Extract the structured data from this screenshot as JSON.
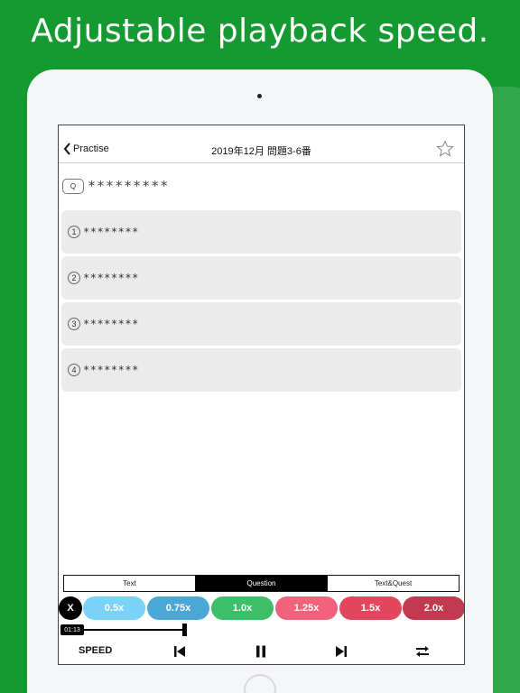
{
  "promo": {
    "title": "Adjustable playback speed."
  },
  "navbar": {
    "back_label": "Practise",
    "title": "2019年12月 問題3-6番"
  },
  "question": {
    "badge": "Q",
    "text": "*********"
  },
  "options": [
    {
      "number": "1",
      "text": "********"
    },
    {
      "number": "2",
      "text": "********"
    },
    {
      "number": "3",
      "text": "********"
    },
    {
      "number": "4",
      "text": "********"
    }
  ],
  "mode_tabs": [
    {
      "label": "Text",
      "active": false
    },
    {
      "label": "Question",
      "active": true
    },
    {
      "label": "Text&Quest",
      "active": false
    }
  ],
  "speed": {
    "close_label": "X",
    "options": [
      {
        "label": "0.5x",
        "color": "#7bd2f7"
      },
      {
        "label": "0.75x",
        "color": "#4ba8d6"
      },
      {
        "label": "1.0x",
        "color": "#3dbf6a"
      },
      {
        "label": "1.25x",
        "color": "#f0637a"
      },
      {
        "label": "1.5x",
        "color": "#e3475e"
      },
      {
        "label": "2.0x",
        "color": "#c23a4f"
      }
    ]
  },
  "player": {
    "time": "01:13",
    "speed_label": "SPEED",
    "icons": [
      "skip-back-icon",
      "pause-icon",
      "skip-forward-icon",
      "repeat-icon"
    ]
  },
  "colors": {
    "background": "#149a30",
    "active_tab": "#000000"
  }
}
